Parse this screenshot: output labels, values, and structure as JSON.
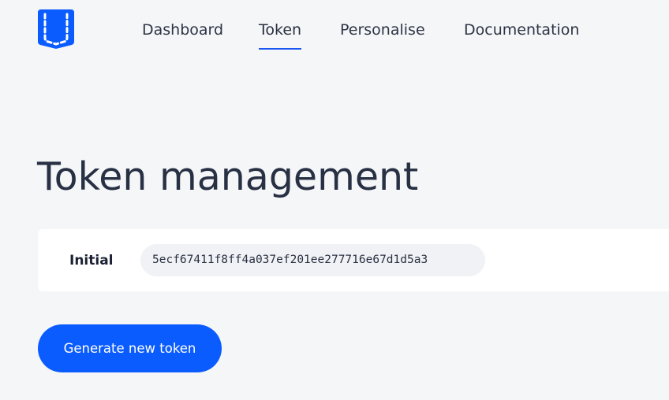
{
  "colors": {
    "accent": "#0b5cff",
    "background": "#f5f6f8",
    "card": "#ffffff",
    "active_underline": "#1a56f0"
  },
  "logo": {
    "icon": "pocket-icon"
  },
  "nav": {
    "items": [
      {
        "label": "Dashboard",
        "active": false
      },
      {
        "label": "Token",
        "active": true
      },
      {
        "label": "Personalise",
        "active": false
      },
      {
        "label": "Documentation",
        "active": false
      }
    ]
  },
  "main": {
    "title": "Token management",
    "tokens": [
      {
        "name": "Initial",
        "value": "5ecf67411f8ff4a037ef201ee277716e67d1d5a3"
      }
    ],
    "generate_label": "Generate new token"
  }
}
